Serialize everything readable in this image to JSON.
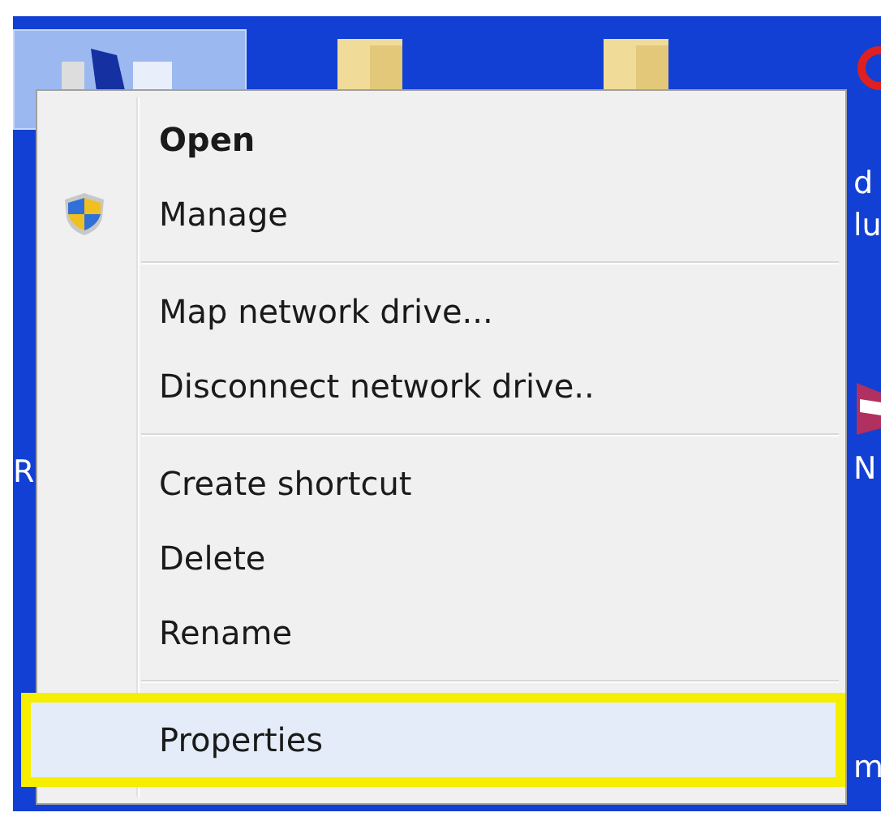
{
  "desktop": {
    "left_labels": [
      "R"
    ],
    "right_labels": [
      "d",
      "lu",
      "N",
      "m"
    ]
  },
  "context_menu": {
    "items": [
      {
        "kind": "item",
        "label": "Open",
        "default": true,
        "selected": false
      },
      {
        "kind": "admin_item",
        "label": "Manage",
        "default": false,
        "selected": false
      },
      {
        "kind": "separator"
      },
      {
        "kind": "item",
        "label": "Map network drive...",
        "default": false,
        "selected": false
      },
      {
        "kind": "item",
        "label": "Disconnect network drive..",
        "default": false,
        "selected": false
      },
      {
        "kind": "separator"
      },
      {
        "kind": "item",
        "label": "Create shortcut",
        "default": false,
        "selected": false
      },
      {
        "kind": "item",
        "label": "Delete",
        "default": false,
        "selected": false
      },
      {
        "kind": "item",
        "label": "Rename",
        "default": false,
        "selected": false
      },
      {
        "kind": "separator"
      },
      {
        "kind": "item",
        "label": "Properties",
        "default": false,
        "selected": true
      }
    ]
  }
}
